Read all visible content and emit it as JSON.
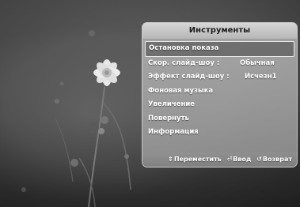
{
  "menu": {
    "title": "Инструменты",
    "items": [
      {
        "label": "Остановка показа",
        "value": null,
        "selected": true
      },
      {
        "label": "Скор. слайд-шоу   :",
        "value": "Обычная"
      },
      {
        "label": "Эффект слайд-шоу :",
        "value": "Исчезн1"
      },
      {
        "label": "Фоновая музыка",
        "value": null
      },
      {
        "label": "Увеличение",
        "value": null
      },
      {
        "label": "Повернуть",
        "value": null
      },
      {
        "label": "Информация",
        "value": null
      }
    ]
  },
  "hints": {
    "move_icon": "updown-arrows-icon",
    "move": "Переместить",
    "enter_icon": "enter-icon",
    "enter": "Ввод",
    "return_icon": "return-icon",
    "return": "Возврат"
  }
}
